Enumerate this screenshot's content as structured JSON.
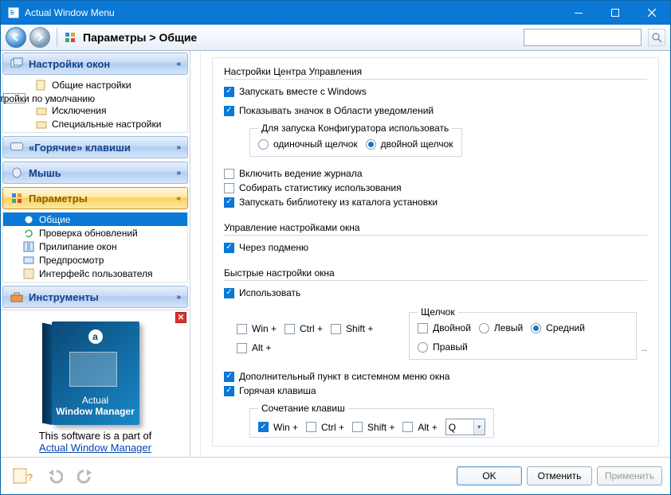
{
  "title": "Actual Window Menu",
  "breadcrumb": "Параметры > Общие",
  "sidebar": {
    "groups": [
      {
        "label": "Настройки окон",
        "expanded": true,
        "active": false,
        "items": [
          {
            "label": "Общие настройки",
            "hasCheckbox": false
          },
          {
            "label": "Настройки по умолчанию",
            "hasCheckbox": true,
            "checked": true
          },
          {
            "label": "Исключения",
            "hasCheckbox": false,
            "indent": true
          },
          {
            "label": "Специальные настройки",
            "hasCheckbox": false
          }
        ]
      },
      {
        "label": "«Горячие» клавиши",
        "expanded": false
      },
      {
        "label": "Мышь",
        "expanded": false
      },
      {
        "label": "Параметры",
        "expanded": true,
        "active": true,
        "items": [
          {
            "label": "Общие",
            "selected": true
          },
          {
            "label": "Проверка обновлений"
          },
          {
            "label": "Прилипание окон"
          },
          {
            "label": "Предпросмотр"
          },
          {
            "label": "Интерфейс пользователя"
          }
        ]
      },
      {
        "label": "Инструменты",
        "expanded": false
      }
    ]
  },
  "promo": {
    "line1_top": "Actual",
    "line1_bottom": "Window Manager",
    "tagline": "This software is a part of",
    "link": "Actual Window Manager"
  },
  "sections": {
    "control_center": {
      "title": "Настройки Центра Управления",
      "run_windows": "Запускать вместе с Windows",
      "tray_icon": "Показывать значок в Области уведомлений",
      "launch_group": "Для запуска Конфигуратора использовать",
      "single_click": "одиночный щелчок",
      "double_click": "двойной щелчок",
      "logging": "Включить ведение журнала",
      "stats": "Собирать статистику использования",
      "run_lib": "Запускать библиотеку из каталога установки"
    },
    "win_settings_mgmt": {
      "title": "Управление настройками окна",
      "via_submenu": "Через подменю"
    },
    "quick": {
      "title": "Быстрые настройки окна",
      "use": "Использовать",
      "win": "Win +",
      "ctrl": "Ctrl +",
      "shift": "Shift +",
      "alt": "Alt +",
      "click_group": "Щелчок",
      "dbl": "Двойной",
      "left": "Левый",
      "mid": "Средний",
      "right": "Правый",
      "extra_menu": "Дополнительный пункт в системном меню окна",
      "hotkey": "Горячая клавиша",
      "combo_label": "Сочетание клавиш",
      "key": "Q"
    }
  },
  "buttons": {
    "ok": "OK",
    "cancel": "Отменить",
    "apply": "Применить"
  }
}
